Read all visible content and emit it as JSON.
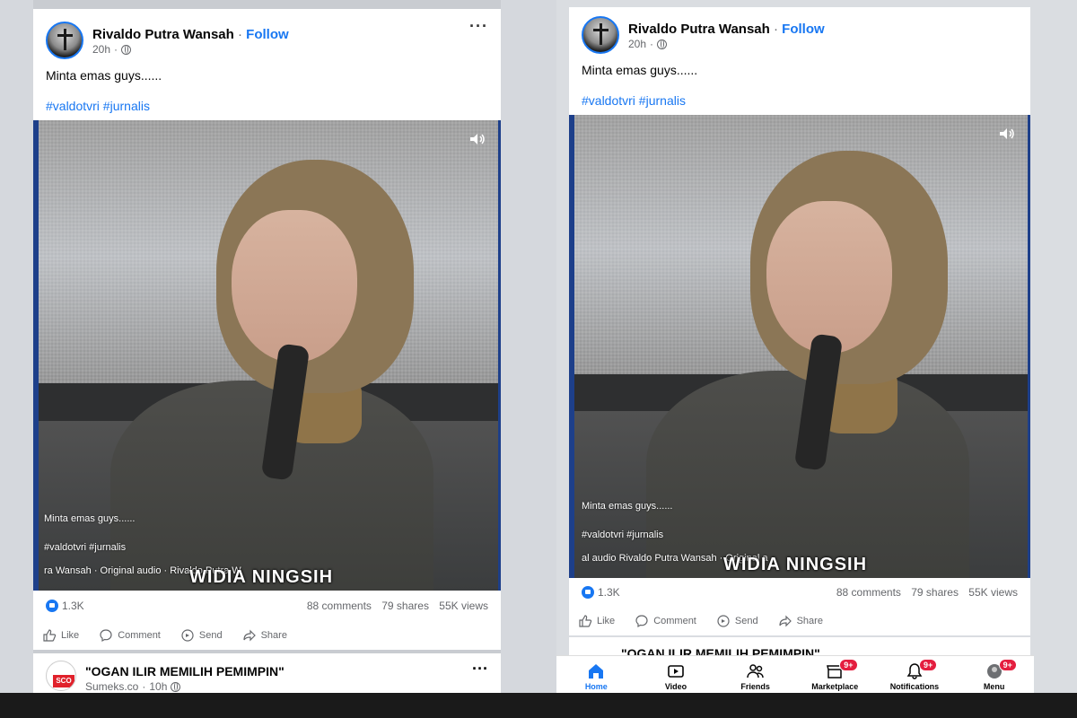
{
  "left_post": {
    "author": "Rivaldo Putra Wansah",
    "separator": "·",
    "follow_label": "Follow",
    "time": "20h",
    "caption": "Minta emas guys......",
    "hashtags": "#valdotvri #jurnalis",
    "video": {
      "overlay_caption": "Minta emas guys......",
      "overlay_hashtags": "#valdotvri #jurnalis",
      "audio_line": "ra Wansah · Original audio · Rivaldo Putra W",
      "lower_third": "WIDIA NINGSIH"
    },
    "likes": "1.3K",
    "comments": "88 comments",
    "shares": "79 shares",
    "views": "55K views",
    "actions": [
      "Like",
      "Comment",
      "Send",
      "Share"
    ]
  },
  "left_next_post": {
    "title": "\"OGAN ILIR MEMILIH PEMIMPIN\"",
    "source": "Sumeks.co",
    "time": "10h",
    "avatar_text": "SCO"
  },
  "right_post": {
    "author": "Rivaldo Putra Wansah",
    "separator": "·",
    "follow_label": "Follow",
    "time": "20h",
    "caption": "Minta emas guys......",
    "hashtags": "#valdotvri #jurnalis",
    "video": {
      "overlay_caption": "Minta emas guys......",
      "overlay_hashtags": "#valdotvri #jurnalis",
      "audio_line": "al audio    Rivaldo Putra Wansah · Original a",
      "lower_third": "WIDIA NINGSIH"
    },
    "likes": "1.3K",
    "comments": "88 comments",
    "shares": "79 shares",
    "views": "55K views",
    "actions": [
      "Like",
      "Comment",
      "Send",
      "Share"
    ]
  },
  "right_next_post": {
    "title": "\"OGAN ILIR MEMILIH PEMIMPIN\""
  },
  "bottom_nav": {
    "items": [
      {
        "label": "Home",
        "badge": ""
      },
      {
        "label": "Video",
        "badge": ""
      },
      {
        "label": "Friends",
        "badge": ""
      },
      {
        "label": "Marketplace",
        "badge": "9+"
      },
      {
        "label": "Notifications",
        "badge": "9+"
      },
      {
        "label": "Menu",
        "badge": "9+"
      }
    ]
  },
  "colors": {
    "brand_blue": "#1877f2",
    "badge_red": "#e41e3f",
    "text_secondary": "#65676b"
  },
  "icons": [
    "avatar",
    "globe-icon",
    "more-icon",
    "volume-icon",
    "like-icon",
    "comment-icon",
    "send-icon",
    "share-icon",
    "home-icon",
    "video-icon",
    "friends-icon",
    "marketplace-icon",
    "notifications-icon",
    "menu-icon"
  ]
}
